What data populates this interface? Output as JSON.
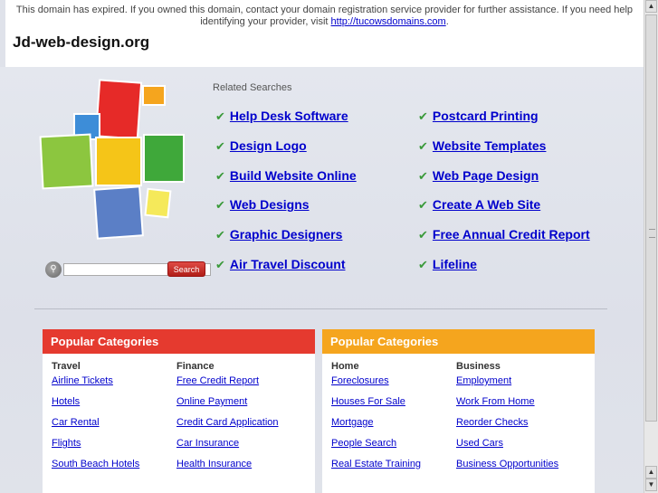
{
  "notice": {
    "text_before_link": "This domain has expired. If you owned this domain, contact your domain registration service provider for further assistance. If you need help identifying your provider, visit ",
    "link": "http://tucowsdomains.com",
    "text_after_link": "."
  },
  "site_title": "Jd-web-design.org",
  "search": {
    "button_label": "Search",
    "value": ""
  },
  "related": {
    "label": "Related Searches",
    "left": [
      "Help Desk Software",
      "Design Logo",
      "Build Website Online",
      "Web Designs",
      "Graphic Designers",
      "Air Travel Discount"
    ],
    "right": [
      "Postcard Printing",
      "Website Templates",
      "Web Page Design",
      "Create A Web Site",
      "Free Annual Credit Report",
      "Lifeline"
    ]
  },
  "panels": [
    {
      "title": "Popular Categories",
      "color": "#e53a2f",
      "columns": [
        {
          "title": "Travel",
          "links": [
            "Airline Tickets",
            "Hotels",
            "Car Rental",
            "Flights",
            "South Beach Hotels"
          ]
        },
        {
          "title": "Finance",
          "links": [
            "Free Credit Report",
            "Online Payment",
            "Credit Card Application",
            "Car Insurance",
            "Health Insurance"
          ]
        }
      ]
    },
    {
      "title": "Popular Categories",
      "color": "#f5a51e",
      "columns": [
        {
          "title": "Home",
          "links": [
            "Foreclosures",
            "Houses For Sale",
            "Mortgage",
            "People Search",
            "Real Estate Training"
          ]
        },
        {
          "title": "Business",
          "links": [
            "Employment",
            "Work From Home",
            "Reorder Checks",
            "Used Cars",
            "Business Opportunities"
          ]
        }
      ]
    }
  ],
  "colors": {
    "link": "#0000cc",
    "check": "#3a9a3a"
  }
}
